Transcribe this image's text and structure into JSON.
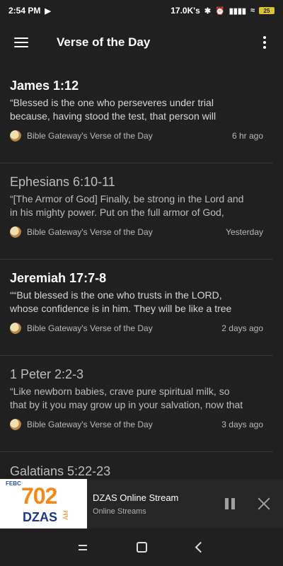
{
  "status_bar": {
    "time": "2:54 PM",
    "speed": "17.0K's",
    "battery": "25"
  },
  "app_bar": {
    "title": "Verse of the Day"
  },
  "feed": {
    "items": [
      {
        "reference": "James 1:12",
        "excerpt_line1": "“Blessed is the one who perseveres under trial",
        "excerpt_line2": "because, having stood the test, that person will",
        "source": "Bible Gateway's Verse of the Day",
        "time": "6 hr ago",
        "read": false
      },
      {
        "reference": "Ephesians 6:10-11",
        "excerpt_line1": "“[The Armor of God] Finally, be strong in the Lord and",
        "excerpt_line2": "in his mighty power. Put on the full armor of God,",
        "source": "Bible Gateway's Verse of the Day",
        "time": "Yesterday",
        "read": true
      },
      {
        "reference": "Jeremiah 17:7-8",
        "excerpt_line1": "““But blessed is the one who trusts in the LORD,",
        "excerpt_line2": "whose confidence is in him. They will be like a tree",
        "source": "Bible Gateway's Verse of the Day",
        "time": "2 days ago",
        "read": false
      },
      {
        "reference": "1 Peter 2:2-3",
        "excerpt_line1": "“Like newborn babies, crave pure spiritual milk, so",
        "excerpt_line2": "that by it you may grow up in your salvation, now that",
        "source": "Bible Gateway's Verse of the Day",
        "time": "3 days ago",
        "read": true
      }
    ],
    "partial_reference": "Galatians 5:22-23"
  },
  "player": {
    "art_top": "FEBC",
    "art_number": "702",
    "art_call": "DZAS",
    "art_band": "AM",
    "title": "DZAS Online Stream",
    "subtitle": "Online Streams"
  },
  "icons": {
    "status": [
      "play-circle-icon",
      "bluetooth-icon",
      "alarm-icon",
      "signal-icon",
      "wifi-icon",
      "battery-icon"
    ],
    "app_bar": [
      "hamburger-menu-icon",
      "more-vert-icon"
    ],
    "player": [
      "pause-icon",
      "close-icon"
    ],
    "nav": [
      "recents-icon",
      "home-icon",
      "back-icon"
    ]
  }
}
